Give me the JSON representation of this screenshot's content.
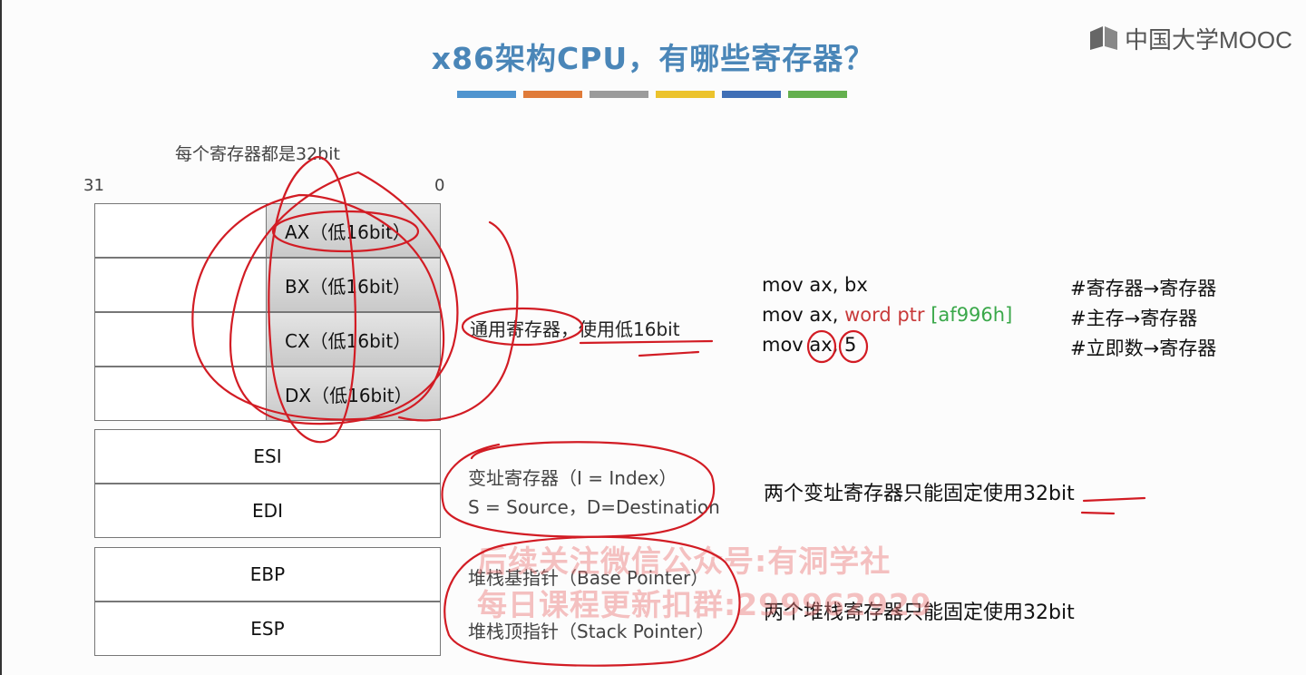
{
  "title": "x86架构CPU，有哪些寄存器？",
  "logo": "中国大学MOOC",
  "bar_colors": [
    "#4f94cf",
    "#e07b39",
    "#9b9b9b",
    "#ecc32c",
    "#3f6fb6",
    "#64b04e"
  ],
  "caption": "每个寄存器都是32bit",
  "bit_high": "31",
  "bit_low": "0",
  "registers": {
    "ax": "AX（低16bit）",
    "bx": "BX（低16bit）",
    "cx": "CX（低16bit）",
    "dx": "DX（低16bit）",
    "esi": "ESI",
    "edi": "EDI",
    "ebp": "EBP",
    "esp": "ESP"
  },
  "notes": {
    "general": "通用寄存器，使用低16bit",
    "index_line1": "变址寄存器（I = Index）",
    "index_line2": "S = Source，D=Destination",
    "base_pointer": "堆栈基指针（Base Pointer）",
    "stack_pointer": "堆栈顶指针（Stack Pointer）"
  },
  "code": [
    {
      "parts": [
        {
          "t": "mov ax, bx",
          "c": ""
        }
      ],
      "comment": "#寄存器→寄存器"
    },
    {
      "parts": [
        {
          "t": "mov ax, ",
          "c": ""
        },
        {
          "t": "word ptr ",
          "c": "red"
        },
        {
          "t": "[af996h]",
          "c": "green"
        }
      ],
      "comment": "#主存→寄存器"
    },
    {
      "parts": [
        {
          "t": "mov ax, 5",
          "c": ""
        }
      ],
      "comment": "#立即数→寄存器"
    }
  ],
  "index_fixed": "两个变址寄存器只能固定使用32bit",
  "stack_fixed": "两个堆栈寄存器只能固定使用32bit",
  "watermark_line1": "后续关注微信公众号:有洞学社",
  "watermark_line2": "每日课程更新扣群:299962929"
}
